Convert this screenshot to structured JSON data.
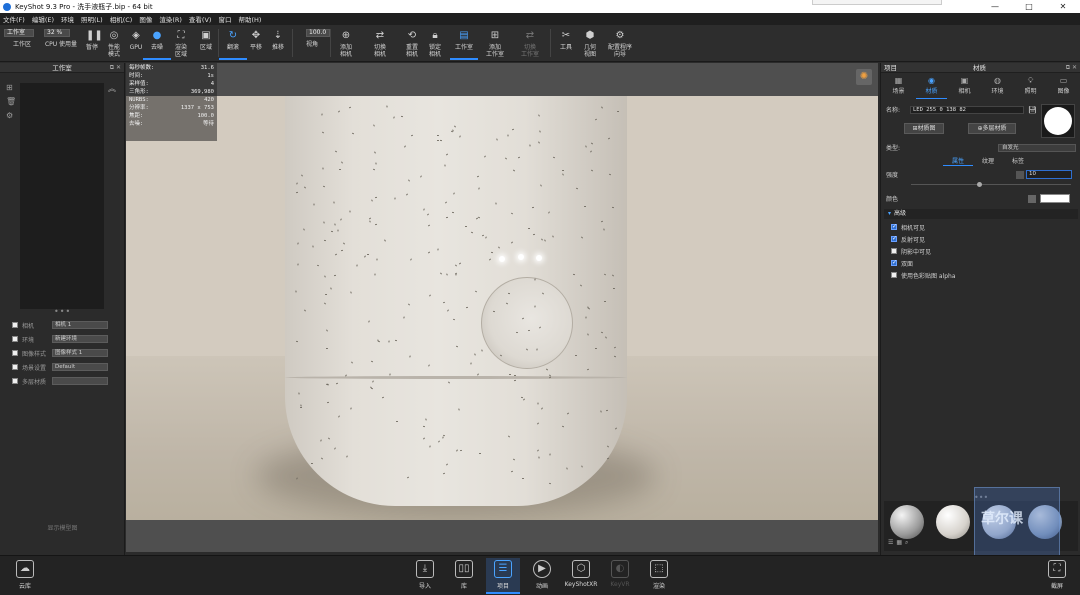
{
  "window": {
    "title": "KeyShot 9.3 Pro  - 洗手液瓶子.bip  - 64 bit",
    "controls": [
      "—",
      "□",
      "✕"
    ]
  },
  "menu": [
    "文件(F)",
    "编辑(E)",
    "环境",
    "照明(L)",
    "相机(C)",
    "图像",
    "渲染(R)",
    "查看(V)",
    "窗口",
    "帮助(H)"
  ],
  "toolbar": {
    "workspace_select": "工作室",
    "cpu_value": "32 %",
    "zoom_value": "100.0",
    "items": [
      {
        "label": "工作区",
        "icon": "workspace-icon"
      },
      {
        "label": "CPU 使用量",
        "icon": "cpu-icon"
      },
      {
        "label": "暂停",
        "icon": "pause-icon"
      },
      {
        "label": "性能\n模式",
        "icon": "performance-icon"
      },
      {
        "label": "GPU",
        "icon": "gpu-icon"
      },
      {
        "label": "去噪",
        "icon": "denoise-icon"
      },
      {
        "label": "渲染\n区域",
        "icon": "render-region-icon"
      },
      {
        "label": "区域",
        "icon": "region-icon"
      },
      {
        "label": "翻滚",
        "icon": "tumble-icon"
      },
      {
        "label": "平移",
        "icon": "pan-icon"
      },
      {
        "label": "推移",
        "icon": "dolly-icon"
      },
      {
        "label": "视角",
        "icon": "fov-icon"
      },
      {
        "label": "添加\n相机",
        "icon": "add-camera-icon"
      },
      {
        "label": "切换\n相机",
        "icon": "switch-camera-icon"
      },
      {
        "label": "重置\n相机",
        "icon": "reset-camera-icon"
      },
      {
        "label": "锁定\n相机",
        "icon": "lock-camera-icon"
      },
      {
        "label": "工作室",
        "icon": "studio-icon"
      },
      {
        "label": "添加\n工作室",
        "icon": "add-studio-icon"
      },
      {
        "label": "切换\n工作室",
        "icon": "switch-studio-icon"
      },
      {
        "label": "工具",
        "icon": "tools-icon"
      },
      {
        "label": "几何\n视图",
        "icon": "geometry-view-icon"
      },
      {
        "label": "配置程序\n向导",
        "icon": "configurator-icon"
      }
    ]
  },
  "left_panel": {
    "title": "工作室",
    "rows": [
      {
        "label": "相机",
        "value": "相机 1"
      },
      {
        "label": "环境",
        "value": "新建环境"
      },
      {
        "label": "图像样式",
        "value": "图像样式 1"
      },
      {
        "label": "场景设置",
        "value": "Default"
      },
      {
        "label": "多层材质",
        "value": ""
      }
    ],
    "footer": "显示模型图"
  },
  "stats": [
    {
      "k": "每秒帧数:",
      "v": "31.6"
    },
    {
      "k": "时间:",
      "v": "1s"
    },
    {
      "k": "采样值:",
      "v": "4"
    },
    {
      "k": "三角形:",
      "v": "369,980"
    },
    {
      "k": "NURBS:",
      "v": "420"
    },
    {
      "k": "分辨率:",
      "v": "1337 x 753"
    },
    {
      "k": "焦距:",
      "v": "100.0"
    },
    {
      "k": "去噪:",
      "v": "等待"
    }
  ],
  "right_panel": {
    "left_title": "项目",
    "center_title": "材质",
    "tabs": [
      {
        "label": "场景",
        "icon": "scene-icon"
      },
      {
        "label": "材质",
        "icon": "material-icon"
      },
      {
        "label": "相机",
        "icon": "camera-icon"
      },
      {
        "label": "环境",
        "icon": "environment-icon"
      },
      {
        "label": "照明",
        "icon": "lighting-icon"
      },
      {
        "label": "图像",
        "icon": "image-icon"
      }
    ],
    "name_label": "名称:",
    "name_value": "LED 255 0 138 82",
    "material_graph_button": "材质图",
    "multilayer_button": "多层材质",
    "type_label": "类型:",
    "type_value": "自发光",
    "subtabs": [
      "属性",
      "纹理",
      "标签"
    ],
    "strength_label": "强度",
    "strength_value": "10",
    "color_label": "颜色",
    "color_swatch": "#ffffff",
    "section_title": "高级",
    "checks": [
      {
        "label": "相机可见",
        "checked": true
      },
      {
        "label": "反射可见",
        "checked": true
      },
      {
        "label": "阴影中可见",
        "checked": false
      },
      {
        "label": "双面",
        "checked": true
      },
      {
        "label": "使用色彩贴图 alpha",
        "checked": false
      }
    ]
  },
  "bottom_bar": [
    {
      "label": "云库",
      "icon": "cloud-library-icon"
    },
    {
      "label": "导入",
      "icon": "import-icon"
    },
    {
      "label": "库",
      "icon": "library-icon"
    },
    {
      "label": "项目",
      "icon": "project-icon",
      "active": true
    },
    {
      "label": "动画",
      "icon": "animation-icon"
    },
    {
      "label": "KeyShotXR",
      "icon": "keyshotxr-icon"
    },
    {
      "label": "KeyVR",
      "icon": "keyvr-icon",
      "dim": true
    },
    {
      "label": "渲染",
      "icon": "render-icon"
    },
    {
      "label": "截屏",
      "icon": "screenshot-icon"
    }
  ],
  "watermark_text": "草尔课"
}
